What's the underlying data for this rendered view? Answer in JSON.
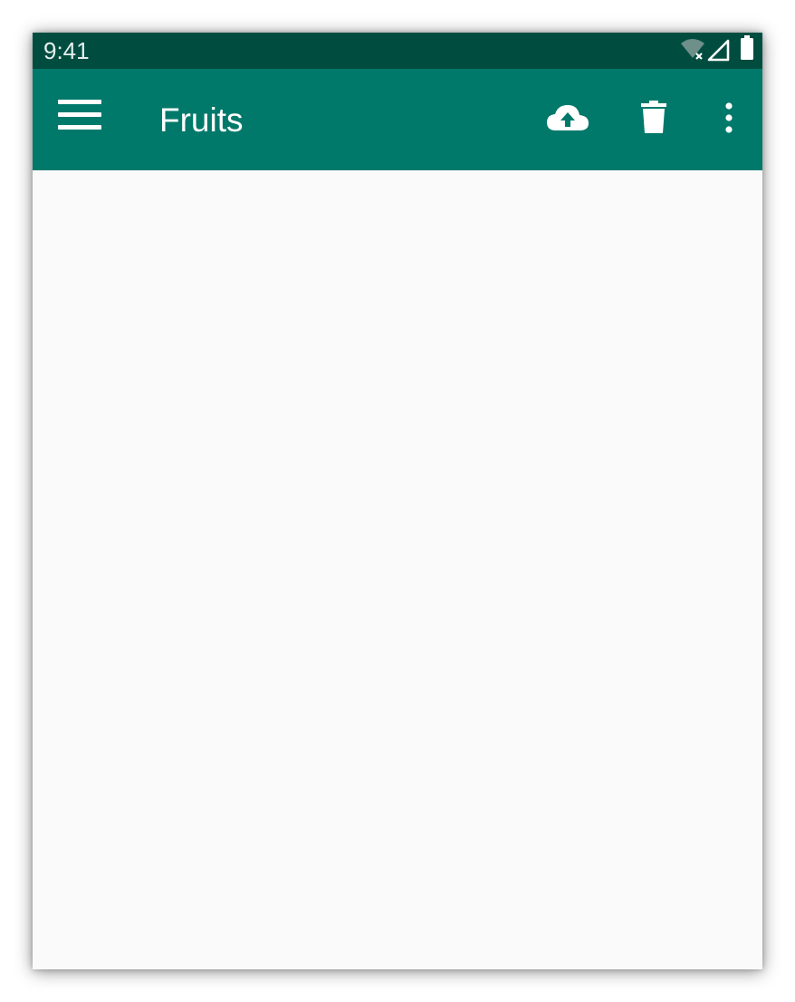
{
  "status_bar": {
    "time": "9:41",
    "icons": [
      "wifi-off-icon",
      "cellular-signal-icon",
      "battery-icon"
    ],
    "background_color": "#004d40"
  },
  "app_bar": {
    "title": "Fruits",
    "background_color": "#00796b",
    "navigation_icon": "menu-icon",
    "actions": [
      "cloud-upload-icon",
      "delete-icon",
      "more-vert-icon"
    ]
  },
  "content": {
    "background_color": "#fafafa"
  }
}
